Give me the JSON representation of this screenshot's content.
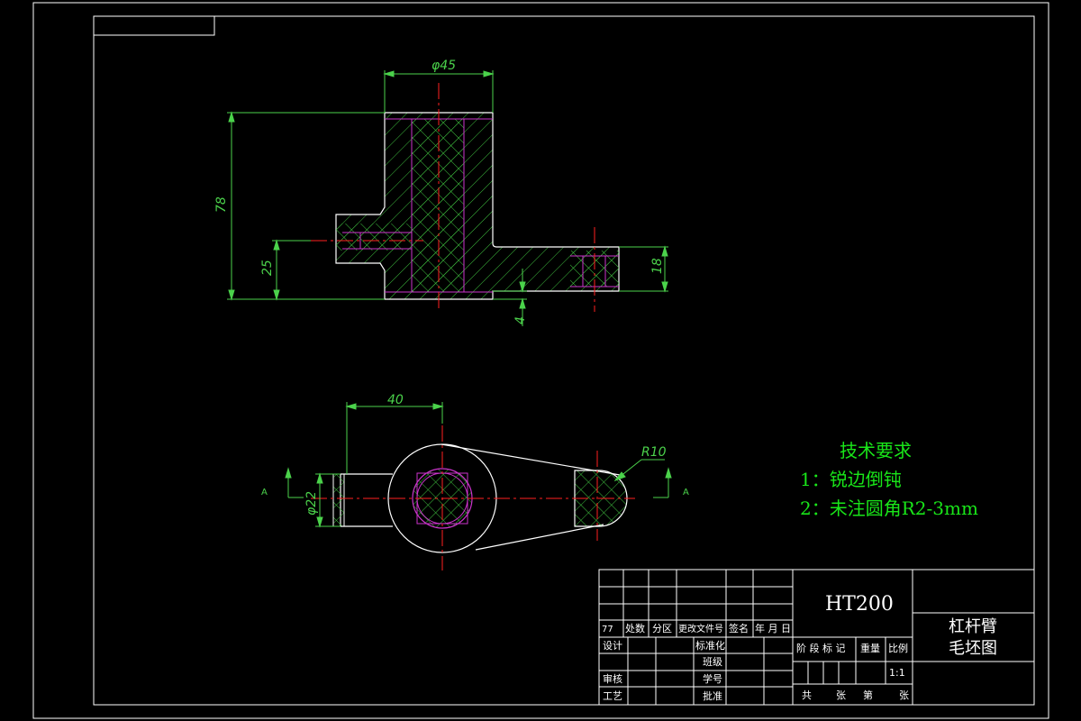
{
  "colors": {
    "background": "#000000",
    "outline": "#ffffff",
    "dimension": "#4bd24b",
    "centerline": "#ff2020",
    "hidden": "#cc33cc",
    "hatch": "#3fbf3f",
    "notes": "#19e619"
  },
  "front_view": {
    "dim_diameter": "φ45",
    "dim_height": "78",
    "dim_boss_height": "25",
    "dim_arm_height": "18",
    "dim_offset": "4"
  },
  "top_view": {
    "dim_length": "40",
    "dim_boss_diameter": "φ22",
    "dim_radius": "R10",
    "section_left": "A",
    "section_right": "A"
  },
  "tech_requirements": {
    "title": "技术要求",
    "item1": "1：锐边倒钝",
    "item2": "2：未注圆角R2-3mm"
  },
  "title_block": {
    "material": "HT200",
    "part_name": "杠杆臂",
    "drawing_name": "毛坯图",
    "revision_mark": "77",
    "col_count": "处数",
    "col_zone": "分区",
    "col_doc_no": "更改文件号",
    "col_signature": "签名",
    "col_date": "年 月 日",
    "design": "设计",
    "standardization": "标准化",
    "class": "班级",
    "review": "审核",
    "student_no": "学号",
    "process": "工艺",
    "approve": "批准",
    "stage_mark": "阶 段 标 记",
    "weight": "重量",
    "scale_label": "比例",
    "scale_value": "1:1",
    "total": "共",
    "sheets": "张",
    "sheet_no": "第",
    "sheet": "张"
  }
}
